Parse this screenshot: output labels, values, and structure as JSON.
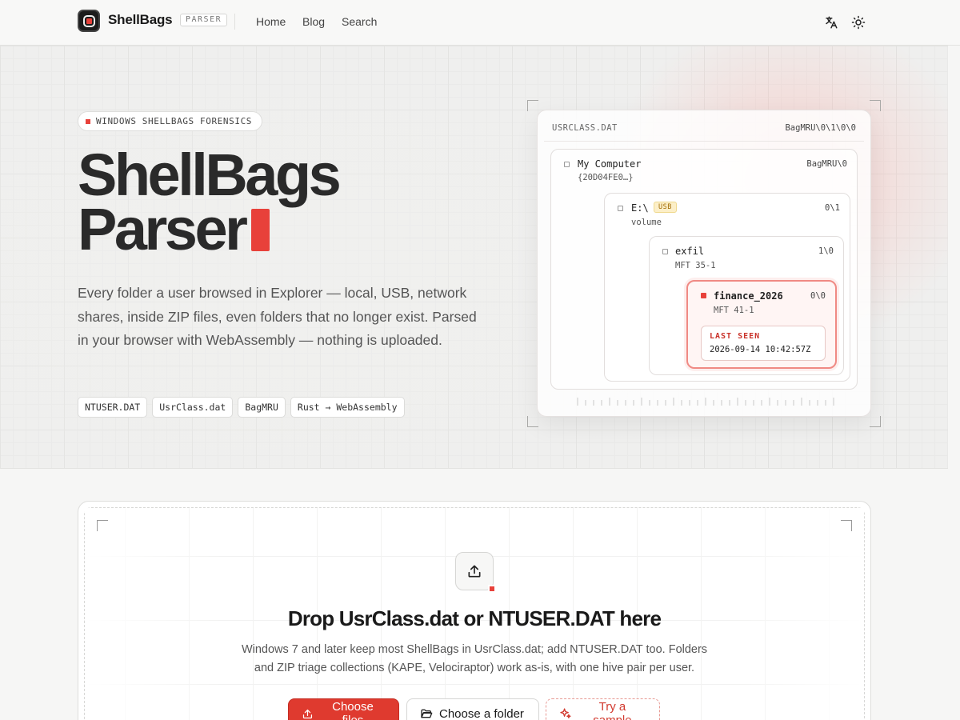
{
  "header": {
    "brand": "ShellBags",
    "badge": "PARSER",
    "nav": [
      "Home",
      "Blog",
      "Search"
    ],
    "translate_icon": "translate-icon",
    "theme_icon": "sun-icon"
  },
  "hero": {
    "pill": "WINDOWS SHELLBAGS FORENSICS",
    "title_line1": "ShellBags",
    "title_line2": "Parser",
    "lede": "Every folder a user browsed in Explorer — local, USB, network shares, inside ZIP files, even folders that no longer exist. Parsed in your browser with WebAssembly — nothing is uploaded.",
    "tags": [
      "NTUSER.DAT",
      "UsrClass.dat",
      "BagMRU",
      "Rust → WebAssembly"
    ]
  },
  "preview": {
    "hive": "USRCLASS.DAT",
    "path": "BagMRU\\0\\1\\0\\0",
    "nodes": [
      {
        "name": "My Computer",
        "sub": "{20D04FE0…}",
        "key": "BagMRU\\0"
      },
      {
        "name": "E:\\",
        "badge": "USB",
        "sub": "volume",
        "key": "0\\1"
      },
      {
        "name": "exfil",
        "sub": "MFT 35-1",
        "key": "1\\0"
      },
      {
        "name": "finance_2026",
        "sub": "MFT 41-1",
        "key": "0\\0"
      }
    ],
    "last_seen_label": "LAST SEEN",
    "last_seen_value": "2026-09-14 10:42:57Z"
  },
  "dropzone": {
    "title": "Drop UsrClass.dat or NTUSER.DAT here",
    "subtitle": "Windows 7 and later keep most ShellBags in UsrClass.dat; add NTUSER.DAT too. Folders and ZIP triage collections (KAPE, Velociraptor) work as-is, with one hive pair per user.",
    "btn_files": "Choose files",
    "btn_folder": "Choose a folder",
    "btn_sample": "Try a sample"
  },
  "colors": {
    "accent": "#e8413a",
    "usb_badge": "#fcefc8"
  }
}
